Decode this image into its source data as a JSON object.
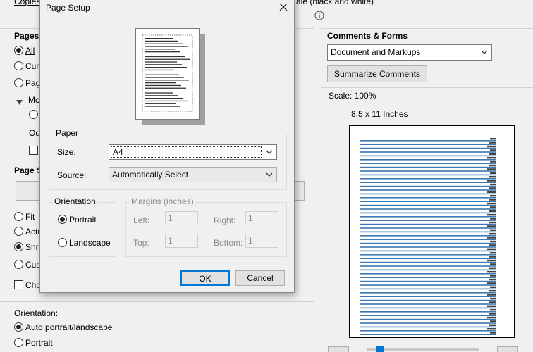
{
  "background": {
    "copies_label": "Copies",
    "grayscale_label": "ale (black and white)",
    "pages_title": "Pages",
    "pages_options": [
      "All",
      "Cur",
      "Pag",
      "Mo"
    ],
    "odd_label": "Od",
    "page_sizing_title": "Page S",
    "sizing_options": [
      "Fit",
      "Actu",
      "Shri",
      "Cus",
      "Cho"
    ],
    "orientation_title": "Orientation:",
    "orientation_options": [
      "Auto portrait/landscape",
      "Portrait"
    ],
    "comments_title": "Comments & Forms",
    "comments_select": "Document and Markups",
    "summarize_button": "Summarize Comments",
    "scale_label": "Scale: 100%",
    "paper_size_label": "8.5 x 11 Inches"
  },
  "dialog": {
    "title": "Page Setup",
    "paper_group": "Paper",
    "size_label": "Size:",
    "size_value": "A4",
    "source_label": "Source:",
    "source_value": "Automatically Select",
    "orientation_group": "Orientation",
    "portrait_label": "Portrait",
    "landscape_label": "Landscape",
    "margins_group": "Margins (inches)",
    "left_label": "Left:",
    "left_value": "1",
    "right_label": "Right:",
    "right_value": "1",
    "top_label": "Top:",
    "top_value": "1",
    "bottom_label": "Bottom:",
    "bottom_value": "1",
    "ok_button": "OK",
    "cancel_button": "Cancel"
  },
  "icons": {
    "close": "close-icon",
    "info": "info-icon",
    "dropdown": "chevron-down-icon",
    "expand": "triangle-down-icon"
  },
  "colors": {
    "dialog_bg": "#f0f0f0",
    "preview_line": "#3c78b4",
    "ok_border": "#0078d7"
  }
}
